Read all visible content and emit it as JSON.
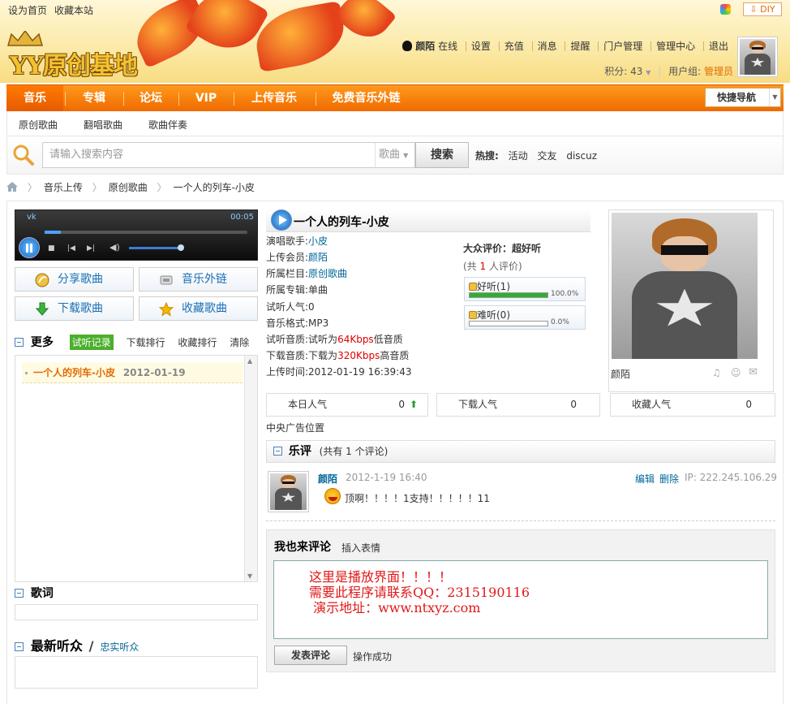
{
  "top_links": {
    "set_home": "设为首页",
    "bookmark": "收藏本站",
    "diy": "DIY"
  },
  "logo": {
    "text": "YY原创基地"
  },
  "user": {
    "name": "颜陌",
    "status": "在线",
    "links": [
      "设置",
      "充值",
      "消息",
      "提醒",
      "门户管理",
      "管理中心",
      "退出"
    ],
    "points_label": "积分: 43",
    "group_label": "用户组:",
    "group_value": "管理员"
  },
  "nav": {
    "items": [
      "音乐",
      "专辑",
      "论坛",
      "VIP",
      "上传音乐",
      "免费音乐外链"
    ],
    "quick": "快捷导航",
    "sub": [
      "原创歌曲",
      "翻唱歌曲",
      "歌曲伴奏"
    ]
  },
  "search": {
    "placeholder": "请输入搜索内容",
    "type": "歌曲",
    "button": "搜索",
    "hot_label": "热搜:",
    "hot": [
      "活动",
      "交友",
      "discuz"
    ]
  },
  "breadcrumb": [
    "音乐上传",
    "原创歌曲",
    "一个人的列车-小皮"
  ],
  "player": {
    "label": "vk",
    "time": "00:05",
    "progress": 0.08,
    "volume": 0.75
  },
  "actions": {
    "share": "分享歌曲",
    "link": "音乐外链",
    "download": "下载歌曲",
    "collect": "收藏歌曲"
  },
  "tabs": {
    "more": "更多",
    "history": "试听记录",
    "download_rank": "下载排行",
    "collect_rank": "收藏排行",
    "clear": "清除"
  },
  "history": [
    {
      "title": "一个人的列车-小皮",
      "date": "2012-01-19"
    }
  ],
  "lyrics_title": "歌词",
  "listeners": {
    "title": "最新听众",
    "sep": "/",
    "loyal": "忠实听众"
  },
  "song": {
    "title": "一个人的列车-小皮",
    "singer_label": "演唱歌手:",
    "singer": "小皮",
    "uploader_label": "上传会员:",
    "uploader": "颜陌",
    "column_label": "所属栏目:",
    "column": "原创歌曲",
    "album_label": "所属专辑:",
    "album": "单曲",
    "popularity_label": "试听人气:",
    "popularity": "0",
    "format_label": "音乐格式:",
    "format": "MP3",
    "listen_quality_label": "试听音质:",
    "listen_quality_pre": "试听为",
    "listen_quality_val": "64Kbps",
    "listen_quality_post": "低音质",
    "download_quality_label": "下载音质:",
    "download_quality_pre": "下载为",
    "download_quality_val": "320Kbps",
    "download_quality_post": "高音质",
    "upload_time_label": "上传时间:",
    "upload_time": "2012-01-19 16:39:43"
  },
  "rating": {
    "title": "大众评价：超好听",
    "count_pre": "(共",
    "count": "1",
    "count_post": "人评价)",
    "good_label": "好听(1)",
    "good_pct": "100.0%",
    "good_value": 1.0,
    "bad_label": "难听(0)",
    "bad_pct": "0.0%",
    "bad_value": 0.0
  },
  "photo_name": "颜陌",
  "stats": [
    {
      "label": "本日人气",
      "value": "0"
    },
    {
      "label": "下载人气",
      "value": "0"
    },
    {
      "label": "收藏人气",
      "value": "0"
    }
  ],
  "ad_text": "中央广告位置",
  "reviews": {
    "title": "乐评",
    "count_pre": "(共有",
    "count": "1",
    "count_post": "个评论)"
  },
  "comment": {
    "author": "颜陌",
    "time": "2012-1-19 16:40",
    "edit": "编辑",
    "delete": "删除",
    "ip": "IP: 222.245.106.29",
    "text": "顶啊！！！！1支持！！！！！11"
  },
  "write": {
    "title": "我也来评论",
    "emoticon": "插入表情",
    "text": "这里是播放界面！！！！\n需要此程序请联系QQ：2315190116\n 演示地址：www.ntxyz.com",
    "submit": "发表评论",
    "status": "操作成功"
  }
}
